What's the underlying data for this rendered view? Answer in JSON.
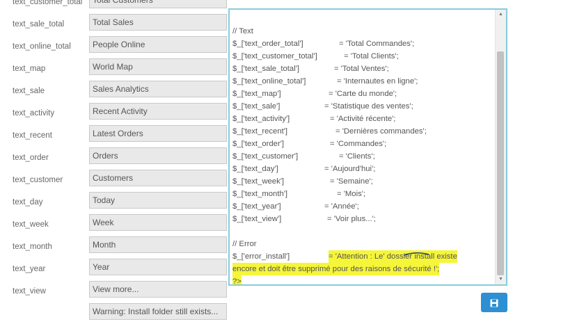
{
  "fields": [
    {
      "key": "text_customer_total",
      "value": "Total Customers"
    },
    {
      "key": "text_sale_total",
      "value": "Total Sales"
    },
    {
      "key": "text_online_total",
      "value": "People Online"
    },
    {
      "key": "text_map",
      "value": "World Map"
    },
    {
      "key": "text_sale",
      "value": "Sales Analytics"
    },
    {
      "key": "text_activity",
      "value": "Recent Activity"
    },
    {
      "key": "text_recent",
      "value": "Latest Orders"
    },
    {
      "key": "text_order",
      "value": "Orders"
    },
    {
      "key": "text_customer",
      "value": "Customers"
    },
    {
      "key": "text_day",
      "value": "Today"
    },
    {
      "key": "text_week",
      "value": "Week"
    },
    {
      "key": "text_month",
      "value": "Month"
    },
    {
      "key": "text_year",
      "value": "Year"
    },
    {
      "key": "text_view",
      "value": "View more..."
    },
    {
      "key": "",
      "value": "Warning: Install folder still exists..."
    }
  ],
  "editor": {
    "comment_text": "// Text",
    "lines": [
      {
        "k": "$_['text_order_total']",
        "v": "= 'Total Commandes';"
      },
      {
        "k": "$_['text_customer_total']",
        "v": "= 'Total Clients';"
      },
      {
        "k": "$_['text_sale_total']",
        "v": "= 'Total Ventes';"
      },
      {
        "k": "$_['text_online_total']",
        "v": "= 'Internautes en ligne';"
      },
      {
        "k": "$_['text_map']",
        "v": "= 'Carte du monde';"
      },
      {
        "k": "$_['text_sale']",
        "v": "= 'Statistique des ventes';"
      },
      {
        "k": "$_['text_activity']",
        "v": "= 'Activité récente';"
      },
      {
        "k": "$_['text_recent']",
        "v": "= 'Dernières commandes';"
      },
      {
        "k": "$_['text_order']",
        "v": "= 'Commandes';"
      },
      {
        "k": "$_['text_customer']",
        "v": "= 'Clients';"
      },
      {
        "k": "$_['text_day']",
        "v": "= 'Aujourd'hui';"
      },
      {
        "k": "$_['text_week']",
        "v": "= 'Semaine';"
      },
      {
        "k": "$_['text_month']",
        "v": "= 'Mois';"
      },
      {
        "k": "$_['text_year']",
        "v": "= 'Année';"
      },
      {
        "k": "$_['text_view']",
        "v": "= 'Voir plus...';"
      }
    ],
    "comment_error": "// Error",
    "error_key": "$_['error_install']",
    "error_value_1": "= 'Attention : Le' dossier install existe",
    "error_value_2": "encore et doit être supprimé pour des raisons de sécurité !';",
    "php_close": "?>"
  },
  "save_icon": "save-icon",
  "colors": {
    "editor_border": "#86ccdf",
    "highlight": "#f5f53a",
    "save_button": "#2e8fd3"
  }
}
